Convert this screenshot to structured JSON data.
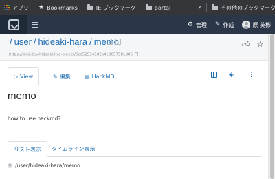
{
  "bookmarks": {
    "items": [
      {
        "label": "アプリ",
        "icon": "apps-grid-icon"
      },
      {
        "label": "Bookmarks",
        "icon": "star-icon"
      },
      {
        "label": "IE ブックマーク",
        "icon": "folder-icon"
      },
      {
        "label": "portal",
        "icon": "folder-icon"
      }
    ],
    "more": "»",
    "other": {
      "label": "その他のブックマーク",
      "icon": "folder-icon"
    },
    "apps_colors": [
      "#ea4335",
      "#fbbc05",
      "#34a853",
      "#4285f4",
      "#ea4335",
      "#fbbc05",
      "#34a853",
      "#4285f4",
      "#ea4335"
    ]
  },
  "navbar": {
    "admin_label": "管理",
    "create_label": "作成",
    "user_name": "原 英彬",
    "colors": {
      "bar": "#2b3748",
      "logo_bg": "#1f2a38"
    }
  },
  "header": {
    "path": [
      "user",
      "hideaki-hara",
      "memo"
    ],
    "path_sep": "/",
    "url": "https://wiki.dev-hideaki.live-on.net/5cc52534182a4e0057581d86"
  },
  "tabs": {
    "view": "View",
    "edit": "編集",
    "hackmd": "HackMD"
  },
  "page": {
    "title": "memo",
    "body": "how to use hackmd?"
  },
  "list_tabs": {
    "list": "リスト表示",
    "timeline": "タイムライン表示"
  },
  "page_list": {
    "item": "/user/hideaki-hara/memo"
  },
  "colors": {
    "link": "#1f6fb2",
    "header_bg": "#f5f6f7"
  }
}
